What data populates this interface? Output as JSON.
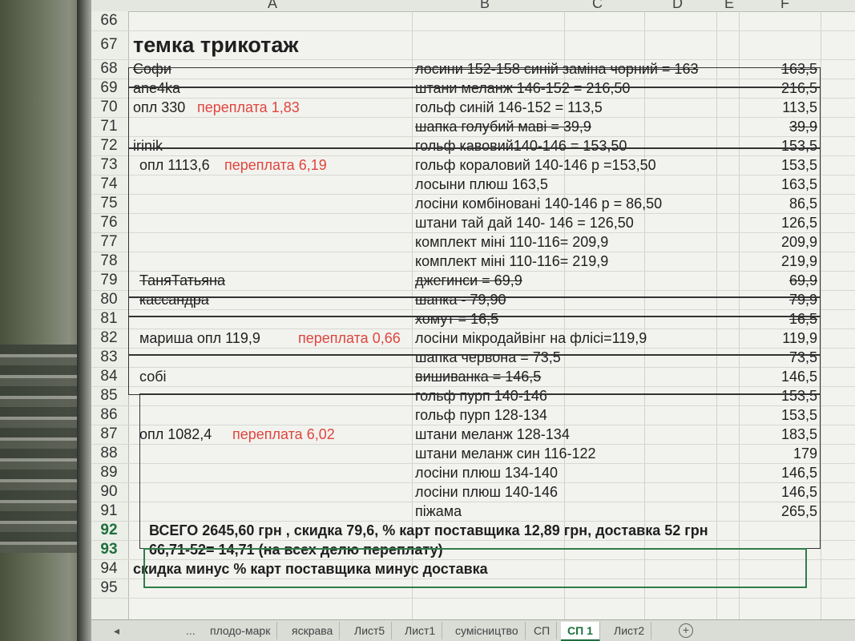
{
  "columns": [
    "A",
    "B",
    "C",
    "D",
    "E",
    "F"
  ],
  "rows": [
    {
      "num": "66",
      "a": "",
      "b": "",
      "f": ""
    },
    {
      "num": "67",
      "a": "темка трикотаж",
      "b": "",
      "f": ""
    },
    {
      "num": "68",
      "a": "Софи",
      "b": "лосини 152-158 синій заміна чорний = 163",
      "f": "163,5"
    },
    {
      "num": "69",
      "a": "ane4ka",
      "b": "штани меланж  146-152 = 216,50",
      "f": "216,5"
    },
    {
      "num": "70",
      "a": "опл 330",
      "a_red": "переплата 1,83",
      "b": "гольф синій 146-152 = 113,5",
      "f": "113,5"
    },
    {
      "num": "71",
      "a": "",
      "b": "шапка голубий маві = 39,9",
      "f": "39,9"
    },
    {
      "num": "72",
      "a": "irinik",
      "b": "гольф кавовий140-146 = 153,50",
      "f": "153,5"
    },
    {
      "num": "73",
      "a": "опл 1113,6",
      "a_red": "переплата 6,19",
      "b": "гольф кораловий 140-146 р =153,50",
      "f": "153,5"
    },
    {
      "num": "74",
      "a": "",
      "b": "лосыни плюш 163,5",
      "f": "163,5"
    },
    {
      "num": "75",
      "a": "",
      "b": "лосіни комбіновані 140-146 р = 86,50",
      "f": "86,5"
    },
    {
      "num": "76",
      "a": "",
      "b": "штани тай дай 140- 146 = 126,50",
      "f": "126,5"
    },
    {
      "num": "77",
      "a": "",
      "b": " комплект міні  110-116= 209,9",
      "f": "209,9"
    },
    {
      "num": "78",
      "a": "",
      "b": " комплект міні  110-116= 219,9",
      "f": "219,9"
    },
    {
      "num": "79",
      "a": "ТаняТатьяна",
      "b": "джегинси = 69,9",
      "f": "69,9"
    },
    {
      "num": "80",
      "a": "кассандра",
      "b": "шапка - 79,90",
      "f": "79,9"
    },
    {
      "num": "81",
      "a": "",
      "b": "хомут = 16,5",
      "f": "16,5"
    },
    {
      "num": "82",
      "a": "мариша     опл 119,9",
      "a_red": "переплата 0,66",
      "b": "лосіни мікродайвінг на флісі=119,9",
      "f": "119,9"
    },
    {
      "num": "83",
      "a": "",
      "b": "шапка червона = 73,5",
      "f": "73,5"
    },
    {
      "num": "84",
      "a": "собі",
      "b": "вишиванка  = 146,5",
      "f": "146,5"
    },
    {
      "num": "85",
      "a": "",
      "b": "гольф пурп 140-146",
      "f": "153,5"
    },
    {
      "num": "86",
      "a": "",
      "b": "гольф пурп 128-134",
      "f": "153,5"
    },
    {
      "num": "87",
      "a": "опл 1082,4",
      "a_red": "переплата   6,02",
      "b": "штани меланж 128-134",
      "f": "183,5"
    },
    {
      "num": "88",
      "a": "",
      "b": "штани меланж син 116-122",
      "f": "179"
    },
    {
      "num": "89",
      "a": "",
      "b": " лосіни плюш 134-140",
      "f": "146,5"
    },
    {
      "num": "90",
      "a": "",
      "b": " лосіни плюш 140-146",
      "f": "146,5"
    },
    {
      "num": "91",
      "a": "",
      "b": "піжама",
      "f": "265,5"
    },
    {
      "num": "92",
      "a": "ВСЕГО 2645,60 грн , скидка 79,6, % карт поставщика 12,89 грн,  доставка 52 грн",
      "b": "",
      "f": ""
    },
    {
      "num": "93",
      "a": "66,71-52= 14,71 (на всех делю переплату)",
      "b": "",
      "f": ""
    },
    {
      "num": "94",
      "a": "скидка минус % карт поставщика  минус доставка",
      "b": "",
      "f": ""
    },
    {
      "num": "95",
      "a": "",
      "b": "",
      "f": ""
    }
  ],
  "tabs": {
    "nav_prev": "◂",
    "ellipsis": "...",
    "items": [
      "плодо-марк",
      "яскрава",
      "Лист5",
      "Лист1",
      "сумісництво",
      "СП",
      "СП 1",
      "Лист2"
    ],
    "add": "+",
    "active": "СП 1"
  },
  "colors": {
    "accent_green": "#1d6f3c",
    "overpay_red": "#e0453e"
  }
}
